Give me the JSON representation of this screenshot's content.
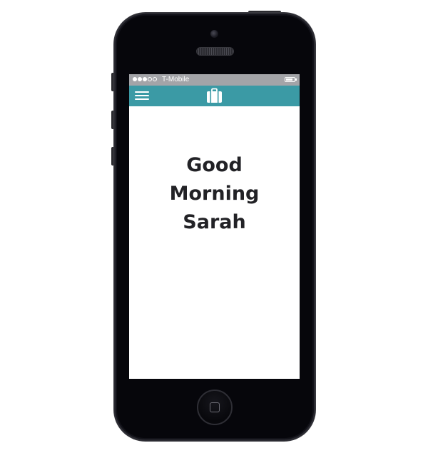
{
  "status_bar": {
    "signal_bars_filled": 3,
    "signal_bars_total": 5,
    "carrier": "T-Mobile",
    "battery_level": 0.85
  },
  "nav_bar": {
    "menu_icon": "hamburger-menu-icon",
    "center_icon": "suitcase-icon",
    "color": "#3b9aa5"
  },
  "main": {
    "greeting_lines": [
      "Good",
      "Morning",
      "Sarah"
    ]
  },
  "colors": {
    "status_bar": "#a3a4a8",
    "nav_bar": "#3b9aa5",
    "greeting_text": "#222226",
    "phone_body": "#06060b"
  }
}
